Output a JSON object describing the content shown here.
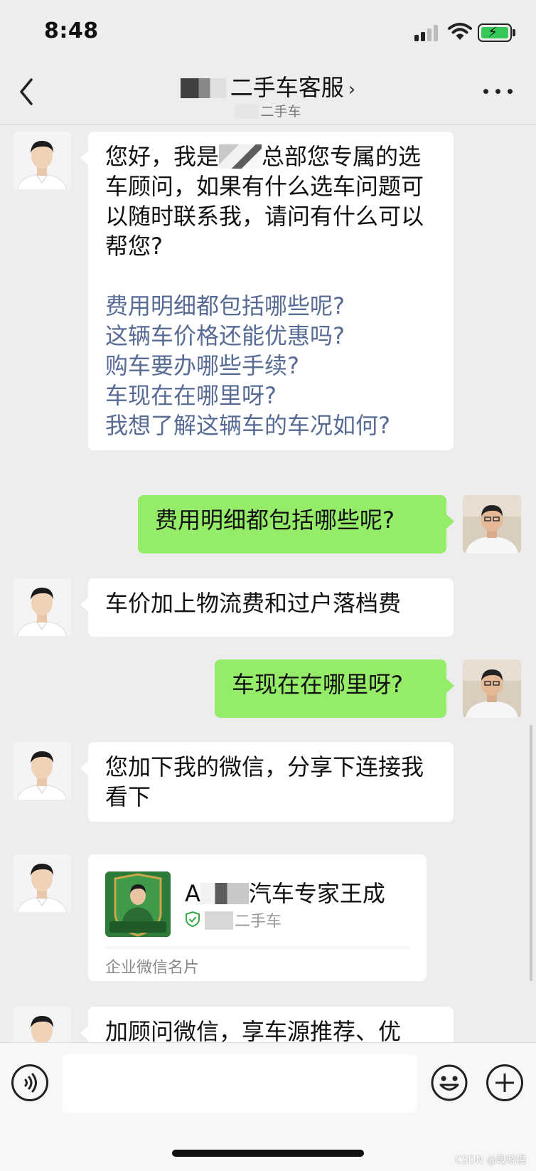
{
  "status_bar": {
    "time": "8:48"
  },
  "header": {
    "title": "二手车客服",
    "subtitle": "二手车"
  },
  "messages": {
    "m1": {
      "line_prefix": "您好，我是",
      "line_rest": "总部您专属的选车顾问，如果有什么选车问题可以随时联系我，请问有什么可以帮您?",
      "quick_questions": [
        "费用明细都包括哪些呢?",
        "这辆车价格还能优惠吗?",
        "购车要办哪些手续?",
        "车现在在哪里呀?",
        "我想了解这辆车的车况如何?"
      ]
    },
    "m2": {
      "text": "费用明细都包括哪些呢?"
    },
    "m3": {
      "text": "车价加上物流费和过户落档费"
    },
    "m4": {
      "text": "车现在在哪里呀?"
    },
    "m5": {
      "text": "您加下我的微信，分享下连接我看下"
    },
    "m6": {
      "name_prefix": "A",
      "name_rest": "汽车专家王成",
      "org": "二手车",
      "card_type": "企业微信名片",
      "card_image_text": "包修 包退 包换"
    },
    "m7": {
      "text": "加顾问微信，享车源推荐、优"
    }
  },
  "input_bar": {
    "placeholder": ""
  },
  "watermark": "CSDN @段晓慢",
  "colors": {
    "background": "#ededed",
    "outgoing_bubble": "#95ec69",
    "incoming_bubble": "#ffffff",
    "link_text": "#576b95"
  },
  "icons": [
    "back-chevron-icon",
    "more-dots-icon",
    "signal-icon",
    "wifi-icon",
    "battery-charging-icon",
    "voice-icon",
    "emoji-icon",
    "plus-icon",
    "verified-shield-icon"
  ]
}
